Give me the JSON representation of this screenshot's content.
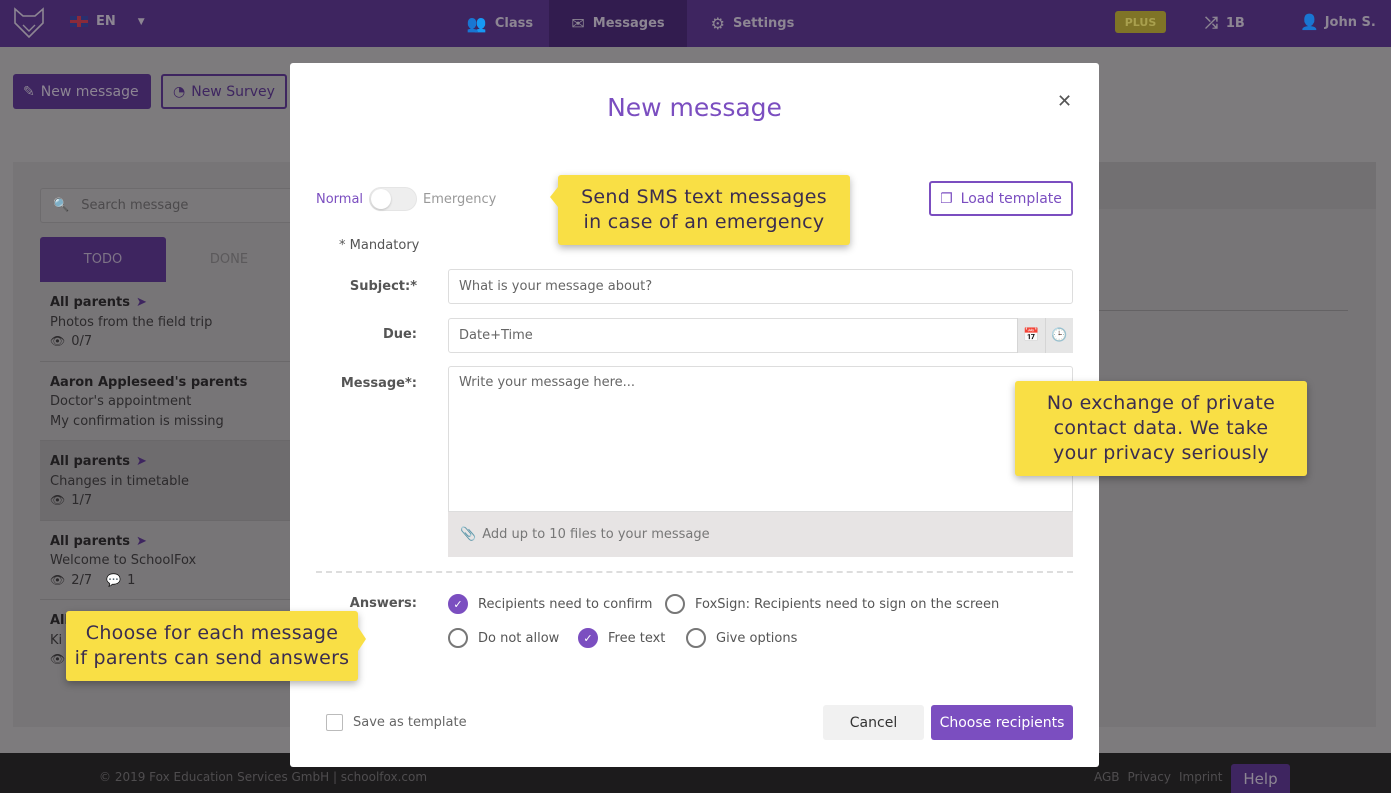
{
  "topbar": {
    "language": "EN",
    "nav": [
      {
        "label": "Class",
        "icon": "users-icon"
      },
      {
        "label": "Messages",
        "icon": "envelope-icon",
        "active": true
      },
      {
        "label": "Settings",
        "icon": "gear-icon"
      }
    ],
    "plus_badge": "PLUS",
    "class_switch": "1B",
    "user": "John S."
  },
  "background": {
    "new_message_btn": "New message",
    "new_survey_btn": "New Survey",
    "search_placeholder": "Search message",
    "tabs": [
      "TODO",
      "DONE"
    ],
    "messages": [
      {
        "recipient": "All parents",
        "subject": "Photos from the field trip",
        "views": "0/7"
      },
      {
        "recipient": "Aaron Appleseed's parents",
        "subject": "Doctor's appointment",
        "note": "My confirmation is missing"
      },
      {
        "recipient": "All parents",
        "subject": "Changes in timetable",
        "views": "1/7"
      },
      {
        "recipient": "All parents",
        "subject": "Welcome to SchoolFox",
        "views": "2/7",
        "comments": "1"
      },
      {
        "recipient": "All parents",
        "subject": "Ki",
        "views": ""
      }
    ]
  },
  "modal": {
    "title": "New message",
    "toggle": {
      "left": "Normal",
      "right": "Emergency"
    },
    "load_template": "Load template",
    "mandatory_note": "* Mandatory",
    "subject": {
      "label": "Subject:*",
      "placeholder": "What is your message about?",
      "value": ""
    },
    "due": {
      "label": "Due:",
      "placeholder": "Date+Time",
      "value": ""
    },
    "message": {
      "label": "Message*:",
      "placeholder": "Write your message here...",
      "value": ""
    },
    "attach": "Add up to 10 files to your message",
    "answers": {
      "label": "Answers:",
      "options": [
        {
          "label": "Recipients need to confirm",
          "checked": true
        },
        {
          "label": "FoxSign: Recipients need to sign on the screen",
          "checked": false
        },
        {
          "label": "Do not allow",
          "checked": false
        },
        {
          "label": "Free text",
          "checked": true
        },
        {
          "label": "Give options",
          "checked": false
        }
      ]
    },
    "save_as_template": "Save as template",
    "cancel": "Cancel",
    "choose_recipients": "Choose recipients"
  },
  "callouts": {
    "sms": [
      "Send SMS text messages",
      "in case of an emergency"
    ],
    "privacy": [
      "No exchange of private",
      "contact data. We take",
      "your privacy seriously"
    ],
    "answers": [
      "Choose for each message",
      "if parents can send answers"
    ]
  },
  "footer": {
    "copyright": "© 2019 Fox Education Services GmbH | schoolfox.com",
    "links": [
      "AGB",
      "Privacy",
      "Imprint"
    ],
    "help": "Help"
  },
  "colors": {
    "brand_purple": "#7b4ec0",
    "nav_dark": "#3e2560",
    "callout_yellow": "#f9df45"
  }
}
